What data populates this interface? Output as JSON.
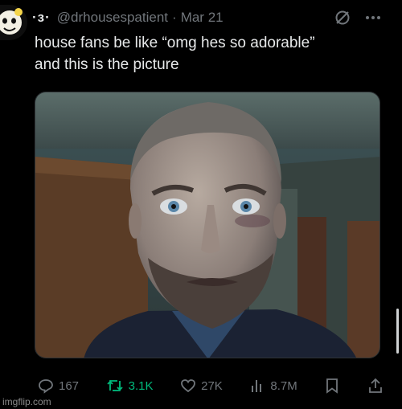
{
  "tweet": {
    "display_name": "·ɜ·",
    "handle": "@drhousespatient",
    "separator": "·",
    "date": "Mar 21",
    "text_lines": [
      "house fans be like “omg hes so adorable”",
      "and this is the picture"
    ],
    "media_description_icon": "photo-of-man-staring"
  },
  "actions": {
    "replies": "167",
    "retweets": "3.1K",
    "likes": "27K",
    "views": "8.7M"
  },
  "icons": {
    "options": "more-options-icon",
    "hidden": "slashed-circle-icon",
    "reply": "reply-icon",
    "retweet": "retweet-icon",
    "like": "heart-icon",
    "views": "views-icon",
    "bookmark": "bookmark-icon",
    "share": "share-icon"
  },
  "colors": {
    "background": "#000000",
    "text": "#e7e9ea",
    "muted": "#71767b",
    "retweet_active": "#00ba7c"
  },
  "watermark": "imgflip.com"
}
